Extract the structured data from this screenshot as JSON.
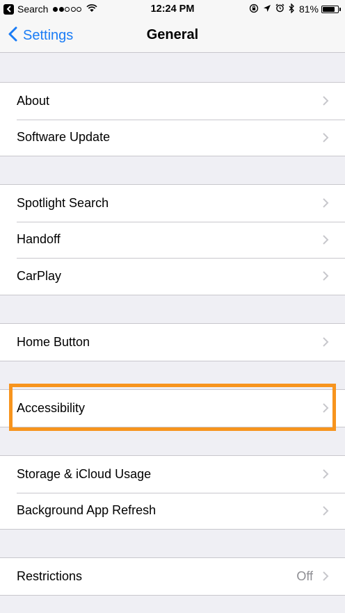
{
  "status_bar": {
    "back_app": "Search",
    "signal_dots_filled": 2,
    "signal_dots_total": 5,
    "time": "12:24 PM",
    "battery": "81%",
    "battery_level": 0.81
  },
  "nav": {
    "back_label": "Settings",
    "title": "General"
  },
  "groups": [
    {
      "rows": [
        {
          "label": "About"
        },
        {
          "label": "Software Update"
        }
      ]
    },
    {
      "rows": [
        {
          "label": "Spotlight Search"
        },
        {
          "label": "Handoff"
        },
        {
          "label": "CarPlay"
        }
      ]
    },
    {
      "rows": [
        {
          "label": "Home Button"
        }
      ]
    },
    {
      "rows": [
        {
          "label": "Accessibility"
        }
      ]
    },
    {
      "rows": [
        {
          "label": "Storage & iCloud Usage"
        },
        {
          "label": "Background App Refresh"
        }
      ]
    },
    {
      "rows": [
        {
          "label": "Restrictions",
          "value": "Off"
        }
      ]
    }
  ],
  "colors": {
    "accent": "#1a7cf6",
    "highlight": "#f7941d",
    "background": "#efeff4"
  }
}
